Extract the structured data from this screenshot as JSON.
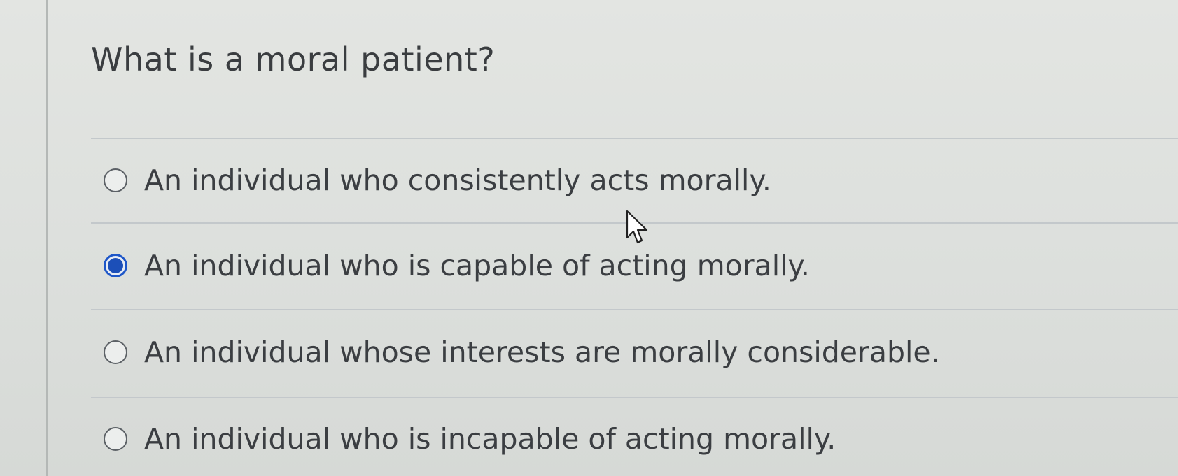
{
  "question": {
    "title": "What is a moral patient?"
  },
  "answers": [
    {
      "label": "An individual who consistently acts morally.",
      "selected": false
    },
    {
      "label": "An individual who is capable of acting morally.",
      "selected": true
    },
    {
      "label": "An individual whose interests are morally considerable.",
      "selected": false
    },
    {
      "label": "An individual who is incapable of acting morally.",
      "selected": false
    }
  ],
  "colors": {
    "selected_radio": "#1c4fb8",
    "text": "#3b3e42",
    "background": "#dfe1de"
  },
  "icons": {
    "cursor": "mouse-pointer-icon"
  }
}
